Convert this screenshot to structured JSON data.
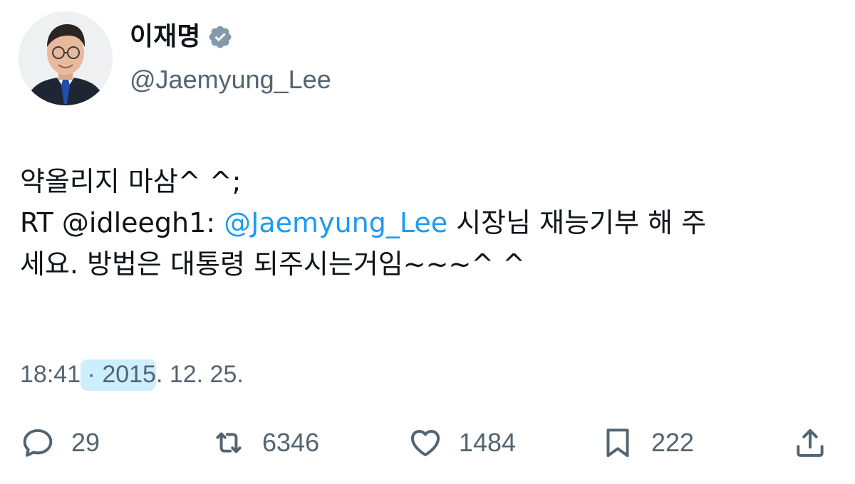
{
  "author": {
    "display_name": "이재명",
    "handle": "@Jaemyung_Lee",
    "verified": true,
    "verified_icon": "verified-badge-icon",
    "avatar": "profile-photo"
  },
  "tweet": {
    "line1": "약올리지 마삼^ ^;",
    "rt_prefix": "RT @idleegh1: ",
    "mention": "@Jaemyung_Lee",
    "line2_rest": " 시장님 재능기부 해 주",
    "line3": "세요. 방법은 대통령 되주시는거임~~~^ ^"
  },
  "meta": {
    "time": "18:41",
    "separator": " · ",
    "year": "2015",
    "date_rest": ". 12. 25."
  },
  "actions": {
    "reply": {
      "icon": "reply-icon",
      "count": "29"
    },
    "retweet": {
      "icon": "retweet-icon",
      "count": "6346"
    },
    "like": {
      "icon": "heart-icon",
      "count": "1484"
    },
    "bookmark": {
      "icon": "bookmark-icon",
      "count": "222"
    },
    "share": {
      "icon": "share-icon"
    }
  },
  "colors": {
    "text": "#0f1419",
    "secondary": "#536471",
    "link": "#1d9bf0",
    "highlight": "#cdeefd"
  }
}
